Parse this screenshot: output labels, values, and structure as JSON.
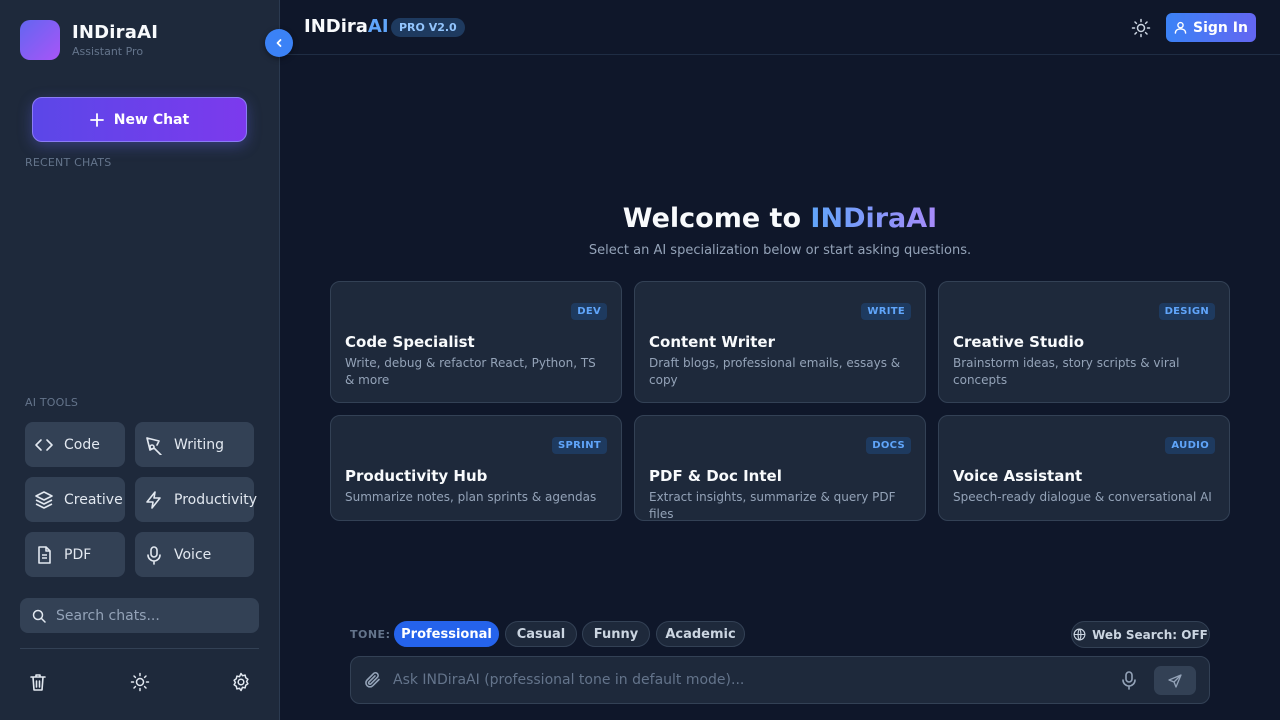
{
  "colors": {
    "accent": "#3b82f6",
    "brand": "#6366f1",
    "background": "#0f172a",
    "panel": "#1e293b"
  },
  "sidebar": {
    "brand_name": "INDiraAI",
    "brand_sub": "Assistant Pro",
    "new_chat_label": "New Chat",
    "recent_label": "RECENT CHATS",
    "tools_label": "AI TOOLS",
    "tools": [
      {
        "label": "Code",
        "icon": "code-icon"
      },
      {
        "label": "Writing",
        "icon": "pen-icon"
      },
      {
        "label": "Creative",
        "icon": "layers-icon"
      },
      {
        "label": "Productivity",
        "icon": "bolt-icon"
      },
      {
        "label": "PDF",
        "icon": "file-icon"
      },
      {
        "label": "Voice",
        "icon": "mic-icon"
      }
    ],
    "search_placeholder": "Search chats...",
    "footer_icons": [
      "trash-icon",
      "sun-icon",
      "gear-icon"
    ]
  },
  "header": {
    "title_main": "INDira",
    "title_accent": "AI",
    "version": "PRO V2.0",
    "signin_label": "Sign In"
  },
  "welcome": {
    "title_prefix": "Welcome to ",
    "title_brand": "INDiraAI",
    "subtitle": "Select an AI specialization below or start asking questions."
  },
  "cards": [
    {
      "tag": "DEV",
      "title": "Code Specialist",
      "desc": "Write, debug & refactor React, Python, TS & more"
    },
    {
      "tag": "WRITE",
      "title": "Content Writer",
      "desc": "Draft blogs, professional emails, essays & copy"
    },
    {
      "tag": "DESIGN",
      "title": "Creative Studio",
      "desc": "Brainstorm ideas, story scripts & viral concepts"
    },
    {
      "tag": "SPRINT",
      "title": "Productivity Hub",
      "desc": "Summarize notes, plan sprints & agendas"
    },
    {
      "tag": "DOCS",
      "title": "PDF & Doc Intel",
      "desc": "Extract insights, summarize & query PDF files"
    },
    {
      "tag": "AUDIO",
      "title": "Voice Assistant",
      "desc": "Speech-ready dialogue & conversational AI"
    }
  ],
  "tone": {
    "label": "TONE:",
    "options": [
      "Professional",
      "Casual",
      "Funny",
      "Academic"
    ],
    "selected": "Professional"
  },
  "web_search_label": "Web Search: OFF",
  "composer": {
    "placeholder": "Ask INDiraAI (professional tone in default mode)..."
  }
}
